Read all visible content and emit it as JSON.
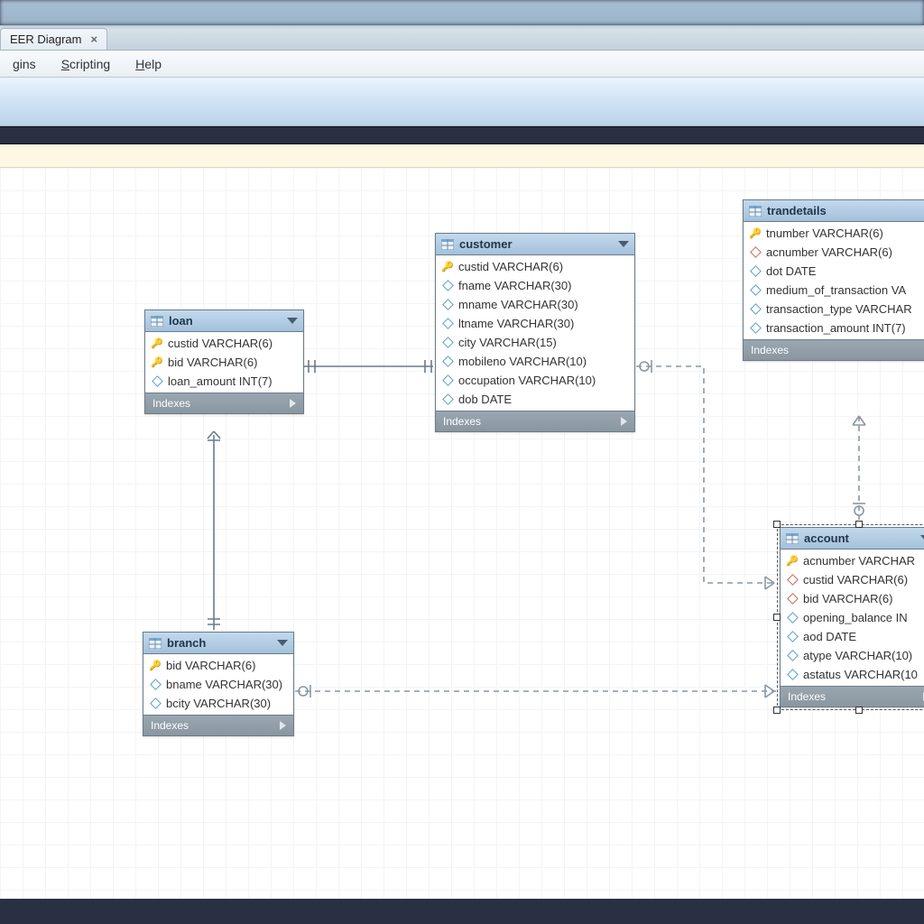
{
  "tab": {
    "label": "EER Diagram",
    "close": "×"
  },
  "menu": {
    "plugins": "gins",
    "scripting": "Scripting",
    "help": "Help"
  },
  "entities": {
    "loan": {
      "title": "loan",
      "indexes": "Indexes",
      "cols": [
        {
          "k": "pk",
          "text": "custid VARCHAR(6)"
        },
        {
          "k": "pk",
          "text": "bid VARCHAR(6)"
        },
        {
          "k": "c",
          "text": "loan_amount INT(7)"
        }
      ]
    },
    "customer": {
      "title": "customer",
      "indexes": "Indexes",
      "cols": [
        {
          "k": "pk",
          "text": "custid VARCHAR(6)"
        },
        {
          "k": "c",
          "text": "fname VARCHAR(30)"
        },
        {
          "k": "c",
          "text": "mname VARCHAR(30)"
        },
        {
          "k": "c",
          "text": "ltname VARCHAR(30)"
        },
        {
          "k": "c",
          "text": "city VARCHAR(15)"
        },
        {
          "k": "c",
          "text": "mobileno VARCHAR(10)"
        },
        {
          "k": "c",
          "text": "occupation VARCHAR(10)"
        },
        {
          "k": "c",
          "text": "dob DATE"
        }
      ]
    },
    "trandetails": {
      "title": "trandetails",
      "indexes": "Indexes",
      "cols": [
        {
          "k": "pk",
          "text": "tnumber VARCHAR(6)"
        },
        {
          "k": "fk",
          "text": "acnumber VARCHAR(6)"
        },
        {
          "k": "c",
          "text": "dot DATE"
        },
        {
          "k": "c",
          "text": "medium_of_transaction VA"
        },
        {
          "k": "c",
          "text": "transaction_type VARCHAR"
        },
        {
          "k": "c",
          "text": "transaction_amount INT(7)"
        }
      ]
    },
    "branch": {
      "title": "branch",
      "indexes": "Indexes",
      "cols": [
        {
          "k": "pk",
          "text": "bid VARCHAR(6)"
        },
        {
          "k": "c",
          "text": "bname VARCHAR(30)"
        },
        {
          "k": "c",
          "text": "bcity VARCHAR(30)"
        }
      ]
    },
    "account": {
      "title": "account",
      "indexes": "Indexes",
      "cols": [
        {
          "k": "pk",
          "text": "acnumber VARCHAR"
        },
        {
          "k": "fk",
          "text": "custid VARCHAR(6)"
        },
        {
          "k": "fk",
          "text": "bid VARCHAR(6)"
        },
        {
          "k": "c",
          "text": "opening_balance IN"
        },
        {
          "k": "c",
          "text": "aod DATE"
        },
        {
          "k": "c",
          "text": "atype VARCHAR(10)"
        },
        {
          "k": "c",
          "text": "astatus VARCHAR(10"
        }
      ]
    }
  }
}
